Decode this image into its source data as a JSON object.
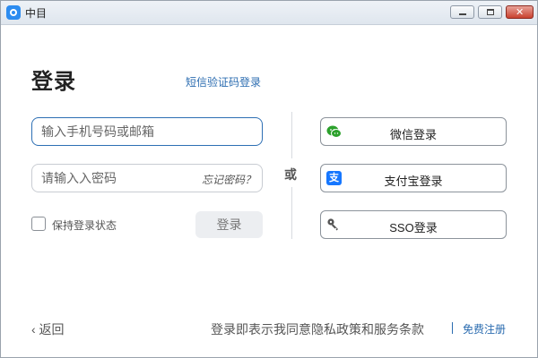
{
  "window": {
    "title": "中目",
    "controls": [
      "minimize-icon",
      "maximize-icon",
      "close-icon"
    ]
  },
  "login": {
    "heading": "登录",
    "sms_link": "短信验证码登录",
    "account_placeholder": "输入手机号码或邮箱",
    "password_placeholder": "请输入入密码",
    "forgot_password": "忘记密码？",
    "remember_label": "保持登录状态",
    "remember_checked": false,
    "login_button": "登录"
  },
  "divider": {
    "or_label": "或"
  },
  "social": [
    {
      "label": "微信登录",
      "icon": "wechat-icon",
      "color": "#2ca12c"
    },
    {
      "label": "支付宝登录",
      "icon": "alipay-icon",
      "color": "#1677ff"
    },
    {
      "label": "SSO登录",
      "icon": "key-icon",
      "color": "#444444"
    }
  ],
  "footer": {
    "back": "‹ 返回",
    "terms": "登录即表示我同意隐私政策和服务条款",
    "register": "免费注册"
  },
  "colors": {
    "link": "#2b6cb0",
    "focus_border": "#2d6fb4"
  }
}
